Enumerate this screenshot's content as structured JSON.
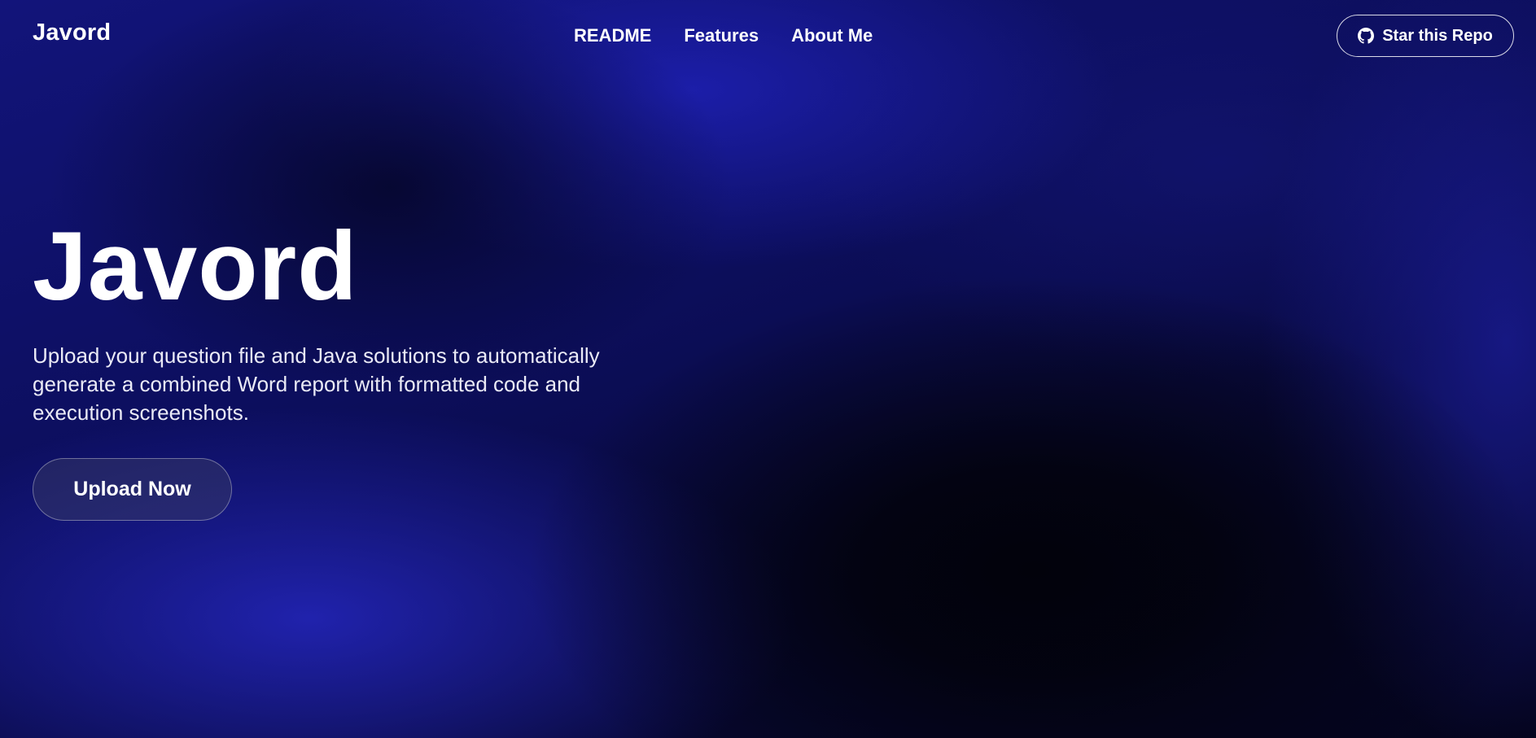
{
  "navbar": {
    "brand": "Javord",
    "links": [
      "README",
      "Features",
      "About Me"
    ],
    "star_button": {
      "label": "Star this Repo",
      "icon": "github-icon"
    }
  },
  "hero": {
    "title": "Javord",
    "description": "Upload your question file and Java solutions to automatically generate a combined Word report with formatted code and execution screenshots.",
    "cta_label": "Upload Now"
  },
  "colors": {
    "background_primary": "#12147a",
    "background_dark": "#04041c",
    "accent_blue": "#2426be",
    "text": "#ffffff"
  }
}
